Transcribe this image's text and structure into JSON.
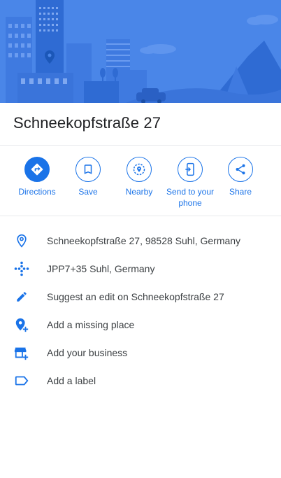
{
  "place": {
    "title": "Schneekopfstraße 27"
  },
  "actions": [
    {
      "label": "Directions",
      "icon": "directions-icon"
    },
    {
      "label": "Save",
      "icon": "bookmark-icon"
    },
    {
      "label": "Nearby",
      "icon": "nearby-icon"
    },
    {
      "label": "Send to your phone",
      "icon": "send-to-phone-icon"
    },
    {
      "label": "Share",
      "icon": "share-icon"
    }
  ],
  "info": [
    {
      "text": "Schneekopfstraße 27, 98528 Suhl, Germany",
      "icon": "location-pin-icon"
    },
    {
      "text": "JPP7+35 Suhl, Germany",
      "icon": "plus-code-icon"
    },
    {
      "text": "Suggest an edit on Schneekopfstraße 27",
      "icon": "pencil-icon"
    },
    {
      "text": "Add a missing place",
      "icon": "add-place-icon"
    },
    {
      "text": "Add your business",
      "icon": "add-business-icon"
    },
    {
      "text": "Add a label",
      "icon": "label-icon"
    }
  ],
  "colors": {
    "accent": "#1a73e8",
    "hero_background": "#3e7be3",
    "text_primary": "#202124",
    "text_secondary": "#3c4043"
  }
}
